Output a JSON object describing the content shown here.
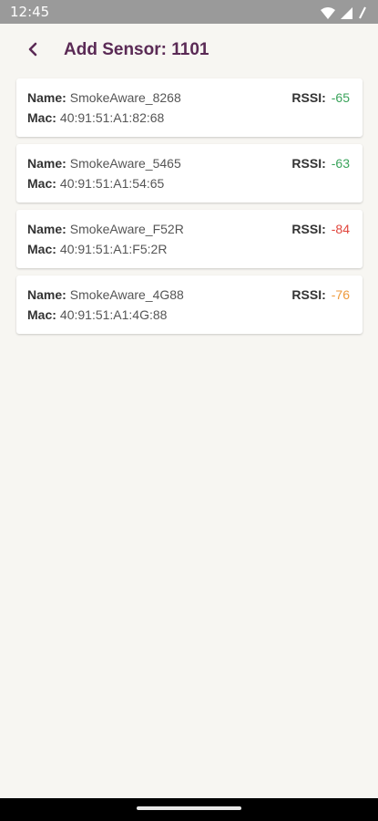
{
  "status_bar": {
    "time": "12:45",
    "icons": [
      "wifi-icon",
      "signal-icon",
      "battery-icon"
    ]
  },
  "header": {
    "title": "Add Sensor: 1101",
    "back_icon": "chevron-left-icon"
  },
  "labels": {
    "name": "Name:",
    "mac": "Mac:",
    "rssi": "RSSI:"
  },
  "sensors": [
    {
      "name": "SmokeAware_8268",
      "mac": "40:91:51:A1:82:68",
      "rssi": "-65",
      "rssi_color": "#3aa35b"
    },
    {
      "name": "SmokeAware_5465",
      "mac": "40:91:51:A1:54:65",
      "rssi": "-63",
      "rssi_color": "#3aa35b"
    },
    {
      "name": "SmokeAware_F52R",
      "mac": "40:91:51:A1:F5:2R",
      "rssi": "-84",
      "rssi_color": "#e0453c"
    },
    {
      "name": "SmokeAware_4G88",
      "mac": "40:91:51:A1:4G:88",
      "rssi": "-76",
      "rssi_color": "#ee9a3c"
    }
  ],
  "colors": {
    "title": "#5a2a55",
    "background": "#f7f6f2",
    "status_bar": "#9a9a9a"
  }
}
